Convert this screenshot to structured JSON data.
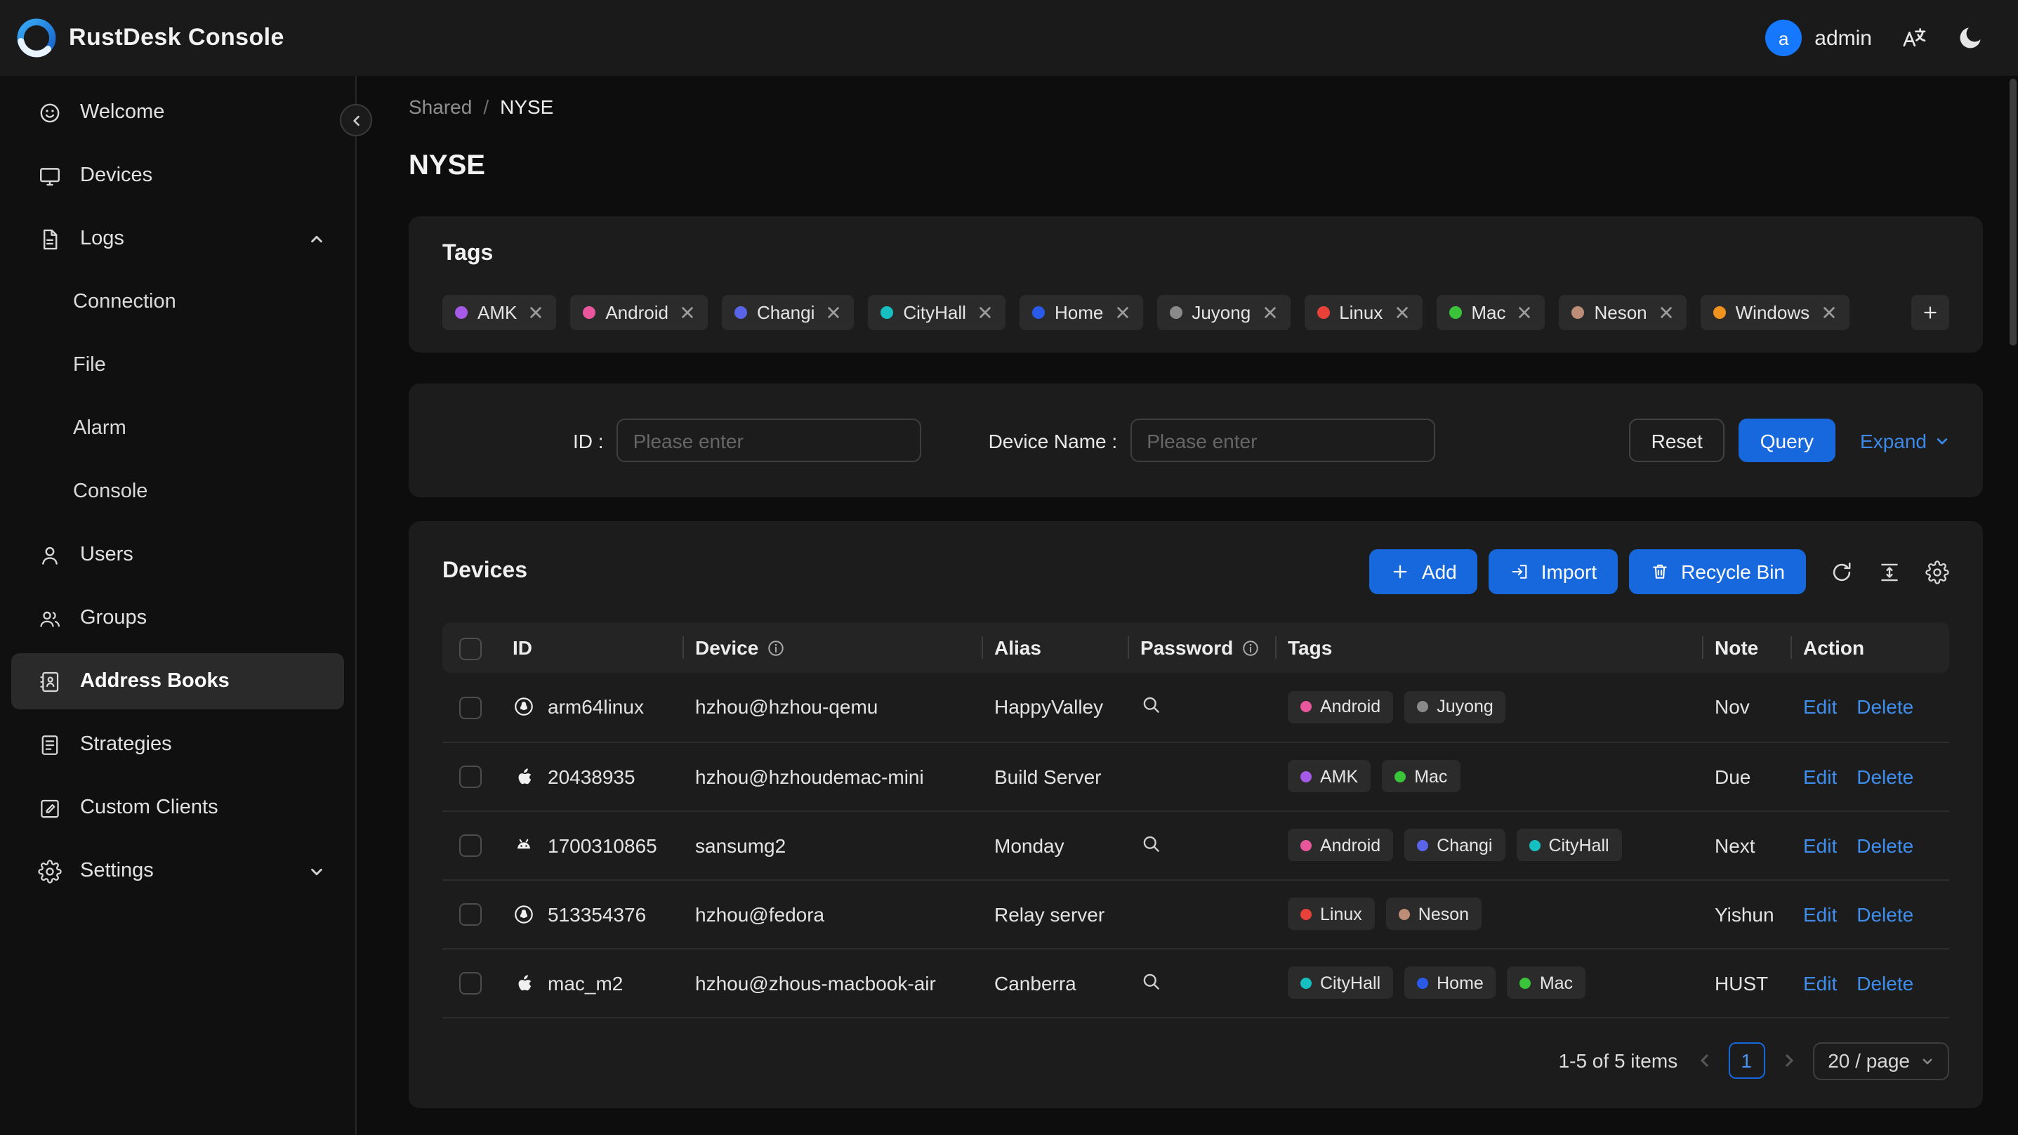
{
  "header": {
    "app_title": "RustDesk Console",
    "user_initial": "a",
    "user_name": "admin"
  },
  "sidebar": {
    "items": [
      {
        "label": "Welcome",
        "icon": "smile-icon"
      },
      {
        "label": "Devices",
        "icon": "desktop-icon"
      },
      {
        "label": "Logs",
        "icon": "file-text-icon",
        "expanded": true,
        "children": [
          {
            "label": "Connection"
          },
          {
            "label": "File"
          },
          {
            "label": "Alarm"
          },
          {
            "label": "Console"
          }
        ]
      },
      {
        "label": "Users",
        "icon": "user-icon"
      },
      {
        "label": "Groups",
        "icon": "team-icon"
      },
      {
        "label": "Address Books",
        "icon": "address-book-icon",
        "active": true
      },
      {
        "label": "Strategies",
        "icon": "strategy-icon"
      },
      {
        "label": "Custom Clients",
        "icon": "custom-clients-icon"
      },
      {
        "label": "Settings",
        "icon": "gear-icon",
        "collapsible": true
      }
    ]
  },
  "breadcrumb": {
    "items": [
      "Shared",
      "NYSE"
    ],
    "separator": "/"
  },
  "page": {
    "title": "NYSE"
  },
  "tags_card": {
    "title": "Tags",
    "tags": [
      {
        "label": "AMK",
        "color": "#a65ae8"
      },
      {
        "label": "Android",
        "color": "#e8569c"
      },
      {
        "label": "Changi",
        "color": "#5a64e8"
      },
      {
        "label": "CityHall",
        "color": "#17c0c0"
      },
      {
        "label": "Home",
        "color": "#2a5ae8"
      },
      {
        "label": "Juyong",
        "color": "#8a8a8a"
      },
      {
        "label": "Linux",
        "color": "#e8413a"
      },
      {
        "label": "Mac",
        "color": "#3ac43a"
      },
      {
        "label": "Neson",
        "color": "#bd8d77"
      },
      {
        "label": "Windows",
        "color": "#f0921e"
      }
    ],
    "add_button": "+"
  },
  "filter_card": {
    "id_label": "ID :",
    "id_placeholder": "Please enter",
    "device_name_label": "Device Name :",
    "device_name_placeholder": "Please enter",
    "reset_label": "Reset",
    "query_label": "Query",
    "expand_label": "Expand"
  },
  "devices_card": {
    "title": "Devices",
    "add_label": "Add",
    "import_label": "Import",
    "recycle_bin_label": "Recycle Bin",
    "table": {
      "columns": [
        {
          "label": "ID"
        },
        {
          "label": "Device",
          "info": true
        },
        {
          "label": "Alias"
        },
        {
          "label": "Password",
          "info": true
        },
        {
          "label": "Tags"
        },
        {
          "label": "Note"
        },
        {
          "label": "Action"
        }
      ],
      "rows": [
        {
          "os_icon": "linux-icon",
          "id": "arm64linux",
          "device": "hzhou@hzhou-qemu",
          "alias": "HappyValley",
          "has_password": true,
          "tags": [
            "Android",
            "Juyong"
          ],
          "note": "Nov"
        },
        {
          "os_icon": "apple-icon",
          "id": "20438935",
          "device": "hzhou@hzhoudemac-mini",
          "alias": "Build Server",
          "has_password": false,
          "tags": [
            "AMK",
            "Mac"
          ],
          "note": "Due"
        },
        {
          "os_icon": "android-icon",
          "id": "1700310865",
          "device": "sansumg2",
          "alias": "Monday",
          "has_password": true,
          "tags": [
            "Android",
            "Changi",
            "CityHall"
          ],
          "note": "Next"
        },
        {
          "os_icon": "linux-icon",
          "id": "513354376",
          "device": "hzhou@fedora",
          "alias": "Relay server",
          "has_password": false,
          "tags": [
            "Linux",
            "Neson"
          ],
          "note": "Yishun"
        },
        {
          "os_icon": "apple-icon",
          "id": "mac_m2",
          "device": "hzhou@zhous-macbook-air",
          "alias": "Canberra",
          "has_password": true,
          "tags": [
            "CityHall",
            "Home",
            "Mac"
          ],
          "note": "HUST"
        }
      ],
      "actions": [
        "Edit",
        "Delete"
      ]
    },
    "pagination": {
      "summary": "1-5 of 5 items",
      "current_page": "1",
      "page_size": "20 / page"
    }
  },
  "colors": {
    "primary": "#1668dc",
    "link": "#3c89e8",
    "avatar": "#1677ff"
  }
}
